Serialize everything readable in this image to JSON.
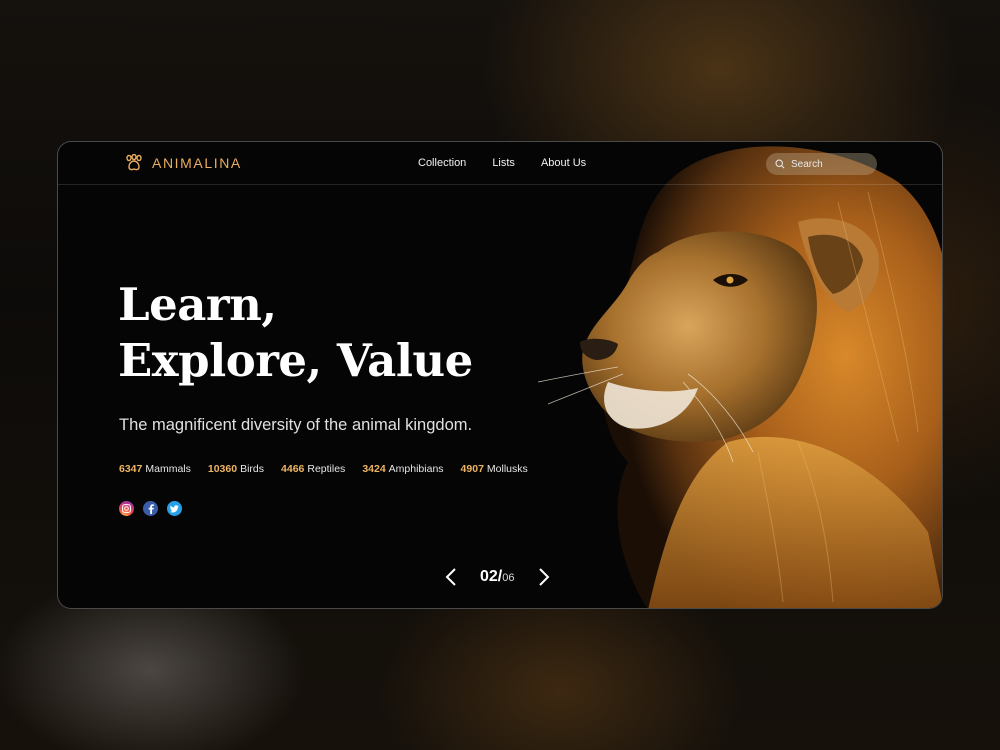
{
  "header": {
    "brand": "ANIMALINA",
    "nav": [
      "Collection",
      "Lists",
      "About Us"
    ],
    "search_placeholder": "Search"
  },
  "hero": {
    "headline_line1": "Learn,",
    "headline_line2": "Explore, Value",
    "subtitle": "The magnificent diversity of the animal kingdom."
  },
  "stats": [
    {
      "count": "6347",
      "label": "Mammals"
    },
    {
      "count": "10360",
      "label": "Birds"
    },
    {
      "count": "4466",
      "label": "Reptiles"
    },
    {
      "count": "3424",
      "label": "Amphibians"
    },
    {
      "count": "4907",
      "label": "Mollusks"
    }
  ],
  "social": [
    "instagram-icon",
    "facebook-icon",
    "twitter-icon"
  ],
  "pager": {
    "current": "02/",
    "total": "06"
  },
  "colors": {
    "accent": "#e9ad5f",
    "stat_number": "#eeb464",
    "background": "#050505"
  }
}
